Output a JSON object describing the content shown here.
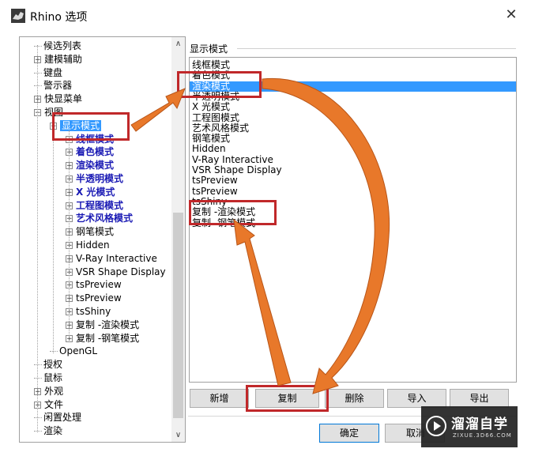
{
  "window": {
    "title": "Rhino 选项",
    "close_glyph": "✕"
  },
  "tree": {
    "items": [
      {
        "label": "候选列表",
        "expandable": false
      },
      {
        "label": "建模辅助",
        "expandable": true
      },
      {
        "label": "键盘",
        "expandable": false
      },
      {
        "label": "警示器",
        "expandable": false
      },
      {
        "label": "快显菜单",
        "expandable": true
      },
      {
        "label": "视图",
        "expandable": true,
        "expanded": true
      },
      {
        "label": "显示模式",
        "expandable": true,
        "expanded": true,
        "selected": true
      },
      {
        "label": "线框模式",
        "bold": true
      },
      {
        "label": "着色模式",
        "bold": true
      },
      {
        "label": "渲染模式",
        "bold": true
      },
      {
        "label": "半透明模式",
        "bold": true
      },
      {
        "label": "X 光模式",
        "bold": true
      },
      {
        "label": "工程图模式",
        "bold": true
      },
      {
        "label": "艺术风格模式",
        "bold": true
      },
      {
        "label": "钢笔模式",
        "bold": false
      },
      {
        "label": "Hidden",
        "bold": false
      },
      {
        "label": "V-Ray Interactive",
        "bold": false
      },
      {
        "label": "VSR Shape Display",
        "bold": false
      },
      {
        "label": "tsPreview",
        "bold": false
      },
      {
        "label": "tsPreview",
        "bold": false
      },
      {
        "label": "tsShiny",
        "bold": false
      },
      {
        "label": "复制 -渲染模式",
        "bold": false
      },
      {
        "label": "复制 -钢笔模式",
        "bold": false
      },
      {
        "label": "OpenGL",
        "expandable": false
      },
      {
        "label": "授权",
        "expandable": false
      },
      {
        "label": "鼠标",
        "expandable": false
      },
      {
        "label": "外观",
        "expandable": true
      },
      {
        "label": "文件",
        "expandable": true
      },
      {
        "label": "闲置处理",
        "expandable": false
      },
      {
        "label": "渲染",
        "expandable": false
      }
    ],
    "scroll_up": "∧",
    "scroll_down": "∨"
  },
  "display_modes": {
    "group_label": "显示模式",
    "items": [
      "线框模式",
      "着色模式",
      "渲染模式",
      "半透明模式",
      "X 光模式",
      "工程图模式",
      "艺术风格模式",
      "钢笔模式",
      "Hidden",
      "V-Ray Interactive",
      "VSR Shape Display",
      "tsPreview",
      "tsPreview",
      "tsShiny",
      "复制 -渲染模式",
      "复制 -钢笔模式"
    ],
    "selected_index": 2
  },
  "buttons": {
    "new": "新增",
    "copy": "复制",
    "delete": "删除",
    "import": "导入",
    "export": "导出",
    "ok": "确定",
    "cancel": "取消"
  },
  "watermark": {
    "title": "溜溜自学",
    "sub": "ZIXUE.3D66.COM"
  },
  "colors": {
    "selection": "#3399ff",
    "annotation_red": "#c0282a",
    "annotation_orange": "#e8782a",
    "bold_node": "#1a1ab4"
  }
}
